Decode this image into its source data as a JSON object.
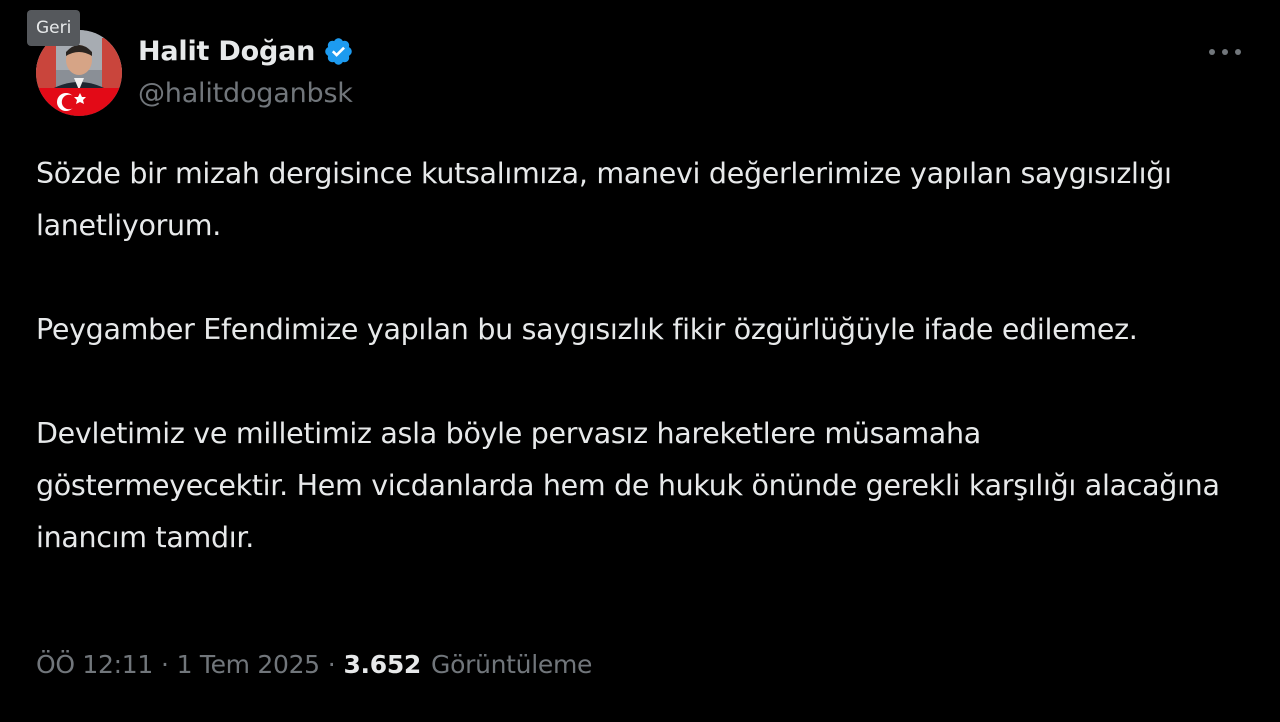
{
  "back_tooltip": "Geri",
  "author": {
    "display_name": "Halit Doğan",
    "handle": "@halitdoganbsk",
    "avatar_icon": "profile-photo-with-flag",
    "verified_icon": "verified-badge-icon",
    "verified_color": "#1d9bf0"
  },
  "more_icon": "more-horizontal-icon",
  "tweet": {
    "paragraphs": [
      "Sözde bir mizah dergisince kutsalımıza, manevi değerlerimize yapılan saygısızlığı  lanetliyorum.",
      "Peygamber Efendimize yapılan bu saygısızlık fikir özgürlüğüyle ifade edilemez.",
      "Devletimiz ve milletimiz asla böyle pervasız hareketlere müsamaha göstermeyecektir. Hem vicdanlarda hem de hukuk önünde gerekli karşılığı alacağına inancım tamdır."
    ]
  },
  "meta": {
    "time": "ÖÖ 12:11",
    "separator_1": "·",
    "date": "1 Tem 2025",
    "separator_2": "·",
    "views_count": "3.652",
    "views_label": "Görüntüleme"
  },
  "colors": {
    "background": "#000000",
    "primary_text": "#e7e9ea",
    "secondary_text": "#71767b",
    "tooltip_bg": "#55585c",
    "accent": "#1d9bf0"
  }
}
